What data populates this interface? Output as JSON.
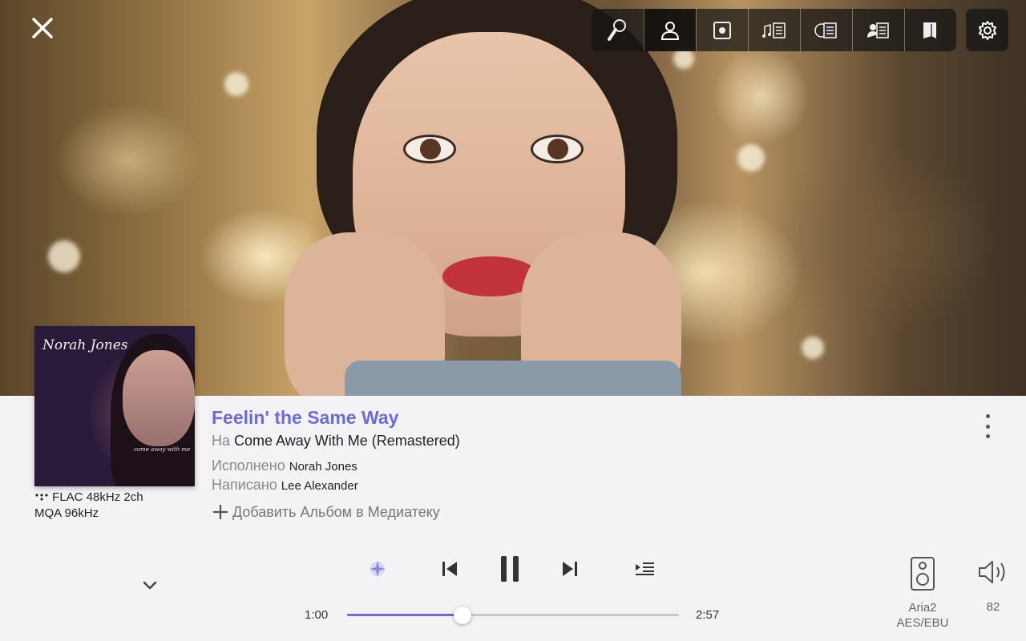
{
  "app": {
    "close_icon": "close-icon"
  },
  "tabs": [
    {
      "name": "tab-focus",
      "icon": "microphone-icon"
    },
    {
      "name": "tab-artist",
      "icon": "person-icon",
      "active": true
    },
    {
      "name": "tab-album",
      "icon": "album-icon"
    },
    {
      "name": "tab-lyrics",
      "icon": "music-notes-icon"
    },
    {
      "name": "tab-credits",
      "icon": "credits-icon"
    },
    {
      "name": "tab-bio",
      "icon": "biography-icon"
    },
    {
      "name": "tab-review",
      "icon": "book-icon"
    }
  ],
  "cover": {
    "artist": "Norah Jones",
    "album": "come away with me"
  },
  "format": {
    "line1": "FLAC 48kHz 2ch",
    "line2": "MQA 96kHz"
  },
  "track": {
    "title": "Feelin' the Same Way",
    "on_label": "На",
    "album": "Come Away With Me (Remastered)",
    "performed_label": "Исполнено",
    "artist": "Norah Jones",
    "written_label": "Написано",
    "writer": "Lee Alexander",
    "add_library": "Добавить Альбом в Медиатеку"
  },
  "playback": {
    "elapsed": "1:00",
    "duration": "2:57",
    "progress": 0.347,
    "state": "playing"
  },
  "device": {
    "name": "Aria2",
    "output": "AES/EBU"
  },
  "volume": {
    "level": "82"
  },
  "colors": {
    "accent": "#6f6bd6",
    "text": "#222222",
    "muted": "#8a8a8a",
    "panel": "#f3f3f5"
  }
}
